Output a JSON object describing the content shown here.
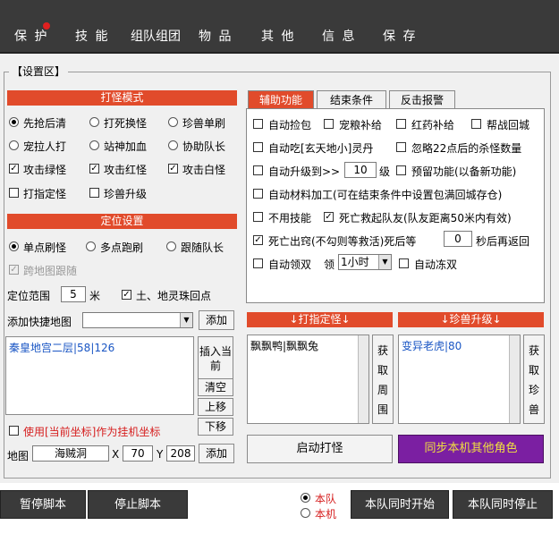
{
  "menu": {
    "items": [
      "保 护",
      "技 能",
      "组队组团",
      "物 品",
      "其 他",
      "信 息",
      "保 存"
    ]
  },
  "group_title": "【设置区】",
  "left": {
    "monster_mode": {
      "title": "打怪模式",
      "opt_first_attack": "先抢后清",
      "opt_kill_switch": "打死换怪",
      "opt_pet_single": "珍兽单刷",
      "opt_pull": "宠拉人打",
      "opt_stand_add": "站神加血",
      "opt_assist_leader": "协助队长",
      "chk_green": "攻击绿怪",
      "chk_red": "攻击红怪",
      "chk_white": "攻击白怪",
      "chk_specific": "打指定怪",
      "chk_pet_upgrade": "珍兽升级"
    },
    "location": {
      "title": "定位设置",
      "opt_single": "单点刷怪",
      "opt_multi": "多点跑刷",
      "opt_follow": "跟随队长",
      "chk_cross_map": "跨地图跟随",
      "range_label": "定位范围",
      "range_value": "5",
      "range_unit": "米",
      "chk_return": "土、地灵珠回点",
      "add_map_label": "添加快捷地图",
      "add_button": "添加",
      "list_item": "秦皇地宫二层|58|126",
      "insert_current": "插入当前",
      "clear": "清空",
      "move_up": "上移",
      "move_down": "下移",
      "chk_use_coord": "使用[当前坐标]作为挂机坐标",
      "map_label": "地图",
      "map_value": "海贼洞",
      "x_label": "X",
      "x_value": "70",
      "y_label": "Y",
      "y_value": "208",
      "add_button2": "添加"
    }
  },
  "right": {
    "tabs": [
      "辅助功能",
      "结束条件",
      "反击报警"
    ],
    "aux": {
      "pick": "自动捡包",
      "pet_food": "宠粮补给",
      "red_medicine": "红药补给",
      "help_return": "帮战回城",
      "eat_pill": "自动吃[玄天地小]灵丹",
      "ignore_kills": "忽略22点后的杀怪数量",
      "upgrade_to": "自动升级到>>",
      "upgrade_level": "10",
      "upgrade_unit": "级",
      "reserve": "预留功能(以备新功能)",
      "material": "自动材料加工(可在结束条件中设置包满回城存仓)",
      "no_skill": "不用技能",
      "revive_team": "死亡救起队友(队友距离50米内有效)",
      "dead_exit": "死亡出窍(不勾则等救活)死后等",
      "dead_wait": "0",
      "dead_wait_unit": "秒后再返回",
      "auto_double": "自动领双",
      "double_label": "领",
      "double_value": "1小时",
      "freeze_double": "自动冻双"
    },
    "attack_specific": {
      "title": "↓打指定怪↓",
      "items": "飘飘鸭|飘飘兔",
      "get_around": "获取周围"
    },
    "pet_upgrade": {
      "title": "↓珍兽升级↓",
      "items": "变异老虎|80",
      "get_pet": "获取珍兽"
    },
    "start_button": "启动打怪",
    "sync_button": "同步本机其他角色"
  },
  "bottom": {
    "pause": "暂停脚本",
    "stop": "停止脚本",
    "team": "本队",
    "local": "本机",
    "start_team": "本队同时开始",
    "stop_team": "本队同时停止"
  },
  "colors": {
    "header": "#e14b2b",
    "sync_button": "#7b1fa2",
    "list_text": "#1a56c4",
    "topbar": "#3a3a3a"
  }
}
